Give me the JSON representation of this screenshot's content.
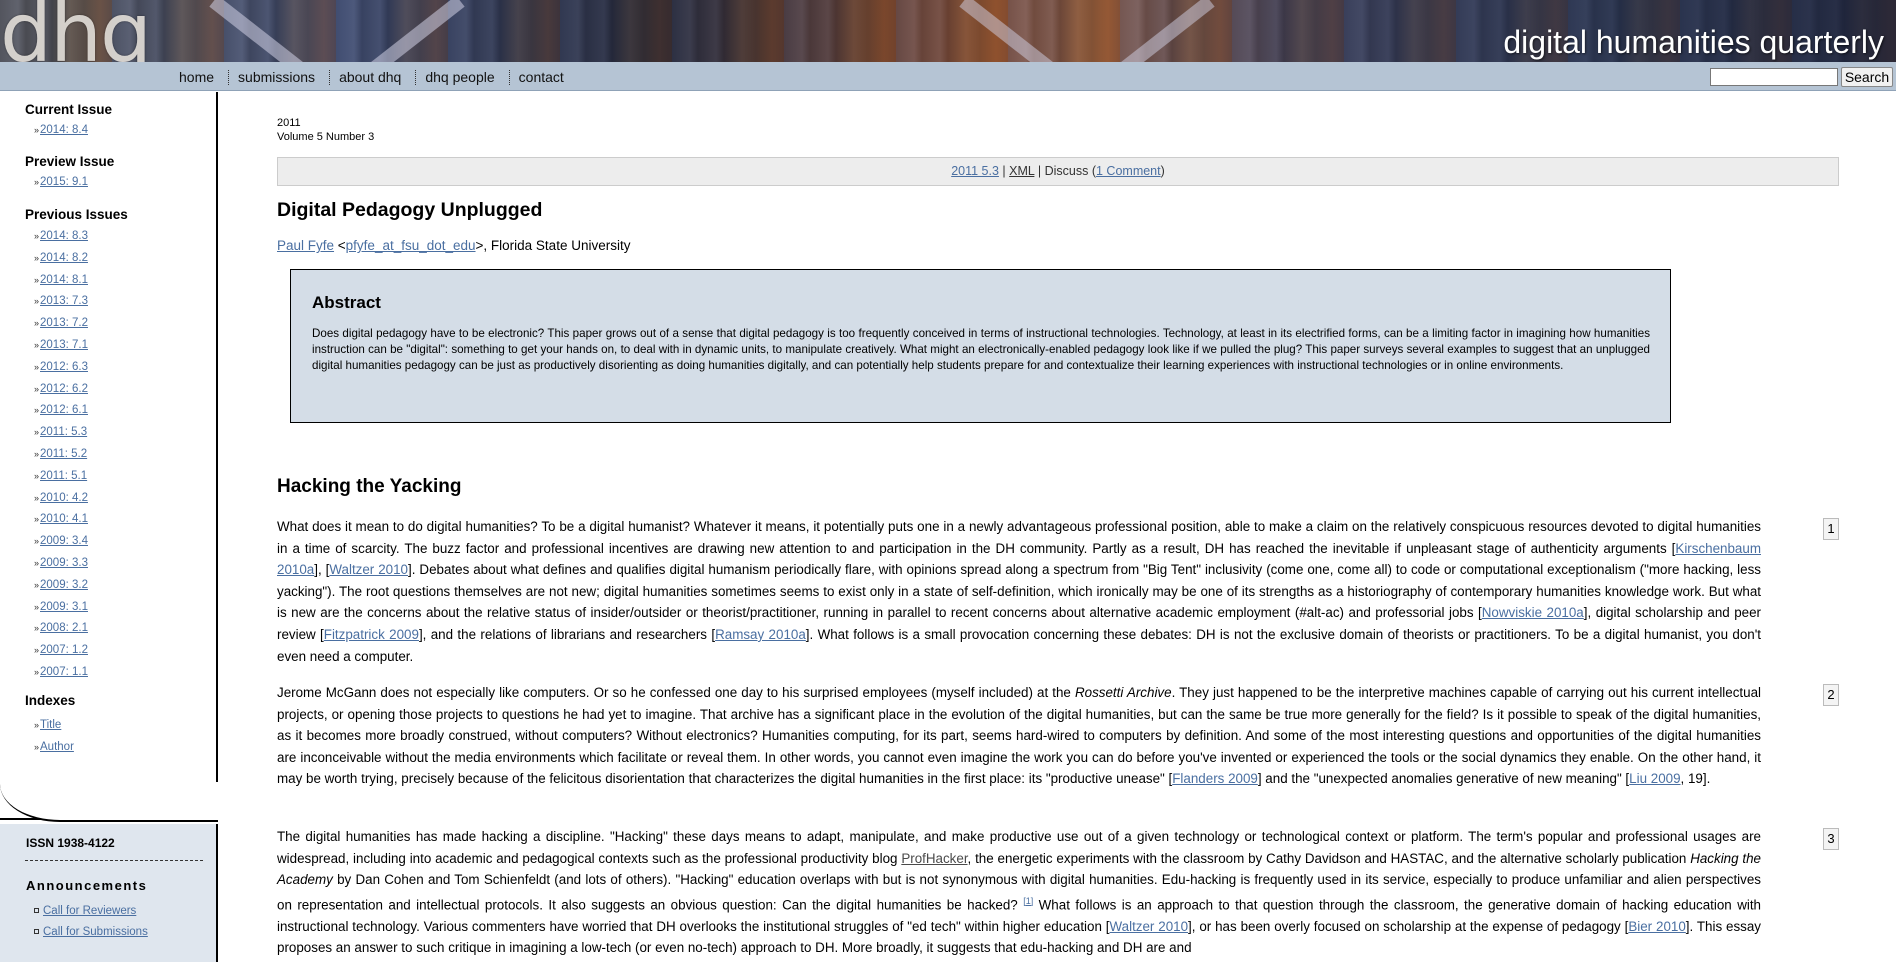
{
  "site": {
    "logo_text": "dhq",
    "title": "digital humanities quarterly"
  },
  "nav": {
    "items": [
      "home",
      "submissions",
      "about dhq",
      "dhq people",
      "contact"
    ],
    "search_button": "Search",
    "search_value": ""
  },
  "sidebar": {
    "current_heading": "Current Issue",
    "current_issue": "2014: 8.4",
    "preview_heading": "Preview Issue",
    "preview_issue": "2015: 9.1",
    "previous_heading": "Previous Issues",
    "previous_issues": [
      "2014: 8.3",
      "2014: 8.2",
      "2014: 8.1",
      "2013: 7.3",
      "2013: 7.2",
      "2013: 7.1",
      "2012: 6.3",
      "2012: 6.2",
      "2012: 6.1",
      "2011: 5.3",
      "2011: 5.2",
      "2011: 5.1",
      "2010: 4.2",
      "2010: 4.1",
      "2009: 3.4",
      "2009: 3.3",
      "2009: 3.2",
      "2009: 3.1",
      "2008: 2.1",
      "2007: 1.2",
      "2007: 1.1"
    ],
    "indexes_heading": "Indexes",
    "indexes": [
      "Title",
      "Author"
    ],
    "issn": "ISSN 1938-4122",
    "announcements_heading": "Announcements",
    "announcements": [
      "Call for Reviewers",
      "Call for Submissions"
    ]
  },
  "issue": {
    "year": "2011",
    "volume": "Volume 5 Number 3"
  },
  "toolbar": {
    "issue_link": "2011 5.3",
    "sep1": " | ",
    "xml": "XML",
    "sep2": " | ",
    "discuss": "Discuss (",
    "comments": "1 Comment",
    "close": ")"
  },
  "article": {
    "title": "Digital Pedagogy Unplugged",
    "author": "Paul Fyfe",
    "email": "pfyfe_at_fsu_dot_edu",
    "affiliation": ">, Florida State University",
    "lt": " <",
    "abstract_heading": "Abstract",
    "abstract_text": "Does digital pedagogy have to be electronic? This paper grows out of a sense that digital pedagogy is too frequently conceived in terms of instructional technologies. Technology, at least in its electrified forms, can be a limiting factor in imagining how humanities instruction can be \"digital\": something to get your hands on, to deal with in dynamic units, to manipulate creatively. What might an electronically-enabled pedagogy look like if we pulled the plug? This paper surveys several examples to suggest that an unplugged digital humanities pedagogy can be just as productively disorienting as doing humanities digitally, and can potentially help students prepare for and contextualize their learning experiences with instructional technologies or in online environments.",
    "section_heading": "Hacking the Yacking"
  },
  "paragraphs": {
    "p1": {
      "num": "1",
      "t1": "What does it mean to do digital humanities? To be a digital humanist? Whatever it means, it potentially puts one in a newly advantageous professional position, able to make a claim on the relatively conspicuous resources devoted to digital humanities in a time of scarcity. The buzz factor and professional incentives are drawing new attention to and participation in the DH community. Partly as a result, DH has reached the inevitable if unpleasant stage of authenticity arguments [",
      "c1": "Kirschenbaum 2010a",
      "t2": "], [",
      "c2": "Waltzer 2010",
      "t3": "]. Debates about what defines and qualifies digital humanism periodically flare, with opinions spread along a spectrum from \"Big Tent\" inclusivity (come one, come all) to code or computational exceptionalism (\"more hacking, less yacking\"). The root questions themselves are not new; digital humanities sometimes seems to exist only in a state of self-definition, which ironically may be one of its strengths as a historiography of contemporary humanities knowledge work. But what is new are the concerns about the relative status of insider/outsider or theorist/practitioner, running in parallel to recent concerns about alternative academic employment (#alt-ac) and professorial jobs [",
      "c3": "Nowviskie 2010a",
      "t4": "], digital scholarship and peer review [",
      "c4": "Fitzpatrick 2009",
      "t5": "], and the relations of librarians and researchers [",
      "c5": "Ramsay 2010a",
      "t6": "]. What follows is a small provocation concerning these debates: DH is not the exclusive domain of theorists or practitioners. To be a digital humanist, you don't even need a computer."
    },
    "p2": {
      "num": "2",
      "t1": "Jerome McGann does not especially like computers. Or so he confessed one day to his surprised employees (myself included) at the ",
      "em1": "Rossetti Archive",
      "t2": ". They just happened to be the interpretive machines capable of carrying out his current intellectual projects, or opening those projects to questions he had yet to imagine. That archive has a significant place in the evolution of the digital humanities, but can the same be true more generally for the field? Is it possible to speak of the digital humanities, as it becomes more broadly construed, without computers? Without electronics? Humanities computing, for its part, seems hard-wired to computers by definition. And some of the most interesting questions and opportunities of the digital humanities are inconceivable without the media environments which facilitate or reveal them. In other words, you cannot even imagine the work you can do before you've invented or experienced the tools or the social dynamics they enable. On the other hand, it may be worth trying, precisely because of the felicitous disorientation that characterizes the digital humanities in the first place: its \"productive unease\" [",
      "c1": "Flanders 2009",
      "t3": "] and the \"unexpected anomalies generative of new meaning\" [",
      "c2": "Liu 2009",
      "t4": ", 19]."
    },
    "p3": {
      "num": "3",
      "t1": "The digital humanities has made hacking a discipline. \"Hacking\" these days means to adapt, manipulate, and make productive use out of a given technology or technological context or platform. The term's popular and professional usages are widespread, including into academic and pedagogical contexts such as the professional productivity blog ",
      "c1": "ProfHacker",
      "t2": ", the energetic experiments with the classroom by Cathy Davidson and HASTAC, and the alternative scholarly publication ",
      "em1": "Hacking the Academy",
      "t3": " by Dan Cohen and Tom Schienfeldt (and lots of others). \"Hacking\" education overlaps with but is not synonymous with digital humanities. Edu-hacking is frequently used in its service, especially to produce unfamiliar and alien perspectives on representation and intellectual protocols. It also suggests an obvious question: Can the digital humanities be hacked? ",
      "fn": "[1]",
      "t4": " What follows is an approach to that question through the classroom, the generative domain of hacking education with instructional technology. Various commenters have worried that DH overlooks the institutional struggles of \"ed tech\" within higher education [",
      "c2": "Waltzer 2010",
      "t5": "], or has been overly focused on scholarship at the expense of pedagogy [",
      "c3": "Bier 2010",
      "t6": "]. This essay proposes an answer to such critique in imagining a low-tech (or even no-tech) approach to DH. More broadly, it suggests that edu-hacking and DH are and"
    }
  }
}
